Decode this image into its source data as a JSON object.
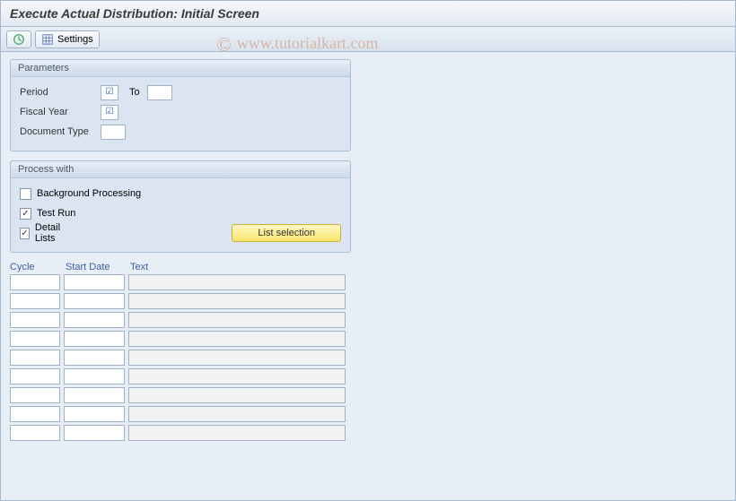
{
  "title": "Execute Actual Distribution: Initial Screen",
  "watermark": "www.tutorialkart.com",
  "toolbar": {
    "settings_label": "Settings"
  },
  "params": {
    "title": "Parameters",
    "period_label": "Period",
    "period_from": "",
    "to_label": "To",
    "period_to": "",
    "fiscal_year_label": "Fiscal Year",
    "fiscal_year": "",
    "doctype_label": "Document Type",
    "doctype": ""
  },
  "process": {
    "title": "Process with",
    "background_label": "Background Processing",
    "background_checked": false,
    "testrun_label": "Test Run",
    "testrun_checked": true,
    "detail_label": "Detail Lists",
    "detail_checked": true,
    "list_selection_label": "List selection"
  },
  "columns": {
    "cycle": "Cycle",
    "start_date": "Start Date",
    "text": "Text"
  },
  "rows": [
    {
      "cycle": "",
      "date": "",
      "text": ""
    },
    {
      "cycle": "",
      "date": "",
      "text": ""
    },
    {
      "cycle": "",
      "date": "",
      "text": ""
    },
    {
      "cycle": "",
      "date": "",
      "text": ""
    },
    {
      "cycle": "",
      "date": "",
      "text": ""
    },
    {
      "cycle": "",
      "date": "",
      "text": ""
    },
    {
      "cycle": "",
      "date": "",
      "text": ""
    },
    {
      "cycle": "",
      "date": "",
      "text": ""
    },
    {
      "cycle": "",
      "date": "",
      "text": ""
    }
  ]
}
